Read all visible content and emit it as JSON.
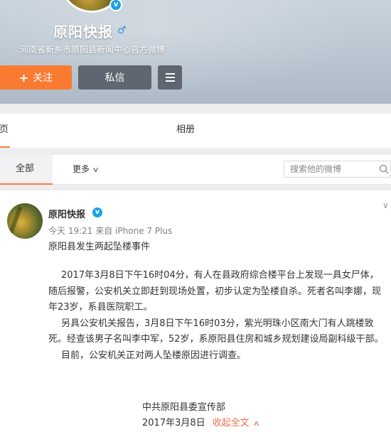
{
  "profile": {
    "name": "原阳快报",
    "verified_mark": "v",
    "gender_symbol": "♂",
    "description": "河南省新乡市原阳县新闻中心官方微博",
    "follow_label": "关注",
    "follow_icon": "+",
    "message_label": "私信",
    "menu_icon": "hamburger-icon"
  },
  "tabs": {
    "home_label": "主页",
    "album_label": "相册"
  },
  "filter": {
    "all_label": "全部",
    "more_label": "更多",
    "more_chevron": "∨",
    "search_placeholder": "搜索他的微博"
  },
  "post": {
    "author": "原阳快报",
    "verified_mark": "v",
    "meta_time": "今天 19:21",
    "meta_from": "来自",
    "meta_device": "iPhone 7 Plus",
    "more_chevron": "∨",
    "title": "原阳县发生两起坠楼事件",
    "paragraph_1": "2017年3月8日下午16时04分，有人在县政府综合楼平台上发现一具女尸体，随后报警，公安机关立即赶到现场处置，初步认定为坠楼自杀。死者名叫李娜，现年23岁，系县医院职工。",
    "paragraph_2": "另具公安机关报告，3月8日下午16时03分，紫光明珠小区南大门有人跳楼致死。经查该男子名叫李中军，52岁，系原阳县住房和城乡规划建设局副科级干部。",
    "paragraph_3": "目前，公安机关正对两人坠楼原因进行调查。",
    "signature": "中共原阳县委宣传部",
    "date": "2017年3月8日",
    "collapse_label": "收起全文",
    "collapse_chevron": "∧"
  },
  "colors": {
    "accent_orange": "#f87b31",
    "button_gray": "#5f6670",
    "verified_blue": "#1d9fe2",
    "link_orange": "#eb7350"
  }
}
